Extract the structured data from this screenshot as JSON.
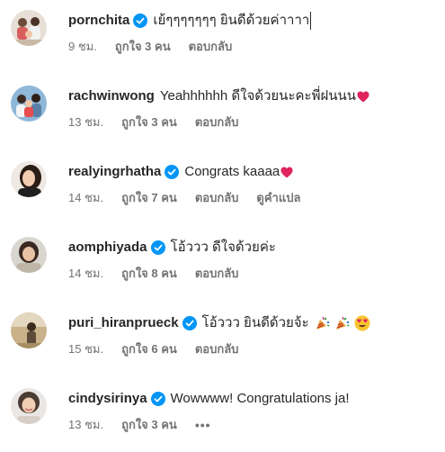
{
  "comments": [
    {
      "username": "pornchita",
      "verified": true,
      "text": "เย้ๆๆๆๆๆๆๆ ยินดีด้วยค่าาาา",
      "time": "9 ชม.",
      "likes": "ถูกใจ 3 คน",
      "reply": "ตอบกลับ",
      "avatar": "group-photo"
    },
    {
      "username": "rachwinwong",
      "verified": false,
      "text": "Yeahhhhhh ดีใจด้วยนะคะพี่ฝนนน",
      "emoji": [
        "heart"
      ],
      "time": "13 ชม.",
      "likes": "ถูกใจ 3 คน",
      "reply": "ตอบกลับ",
      "avatar": "family-photo"
    },
    {
      "username": "realyingrhatha",
      "verified": true,
      "text": "Congrats kaaaa",
      "emoji": [
        "heart"
      ],
      "time": "14 ชม.",
      "likes": "ถูกใจ 7 คน",
      "reply": "ตอบกลับ",
      "translate": "ดูคำแปล",
      "avatar": "portrait"
    },
    {
      "username": "aomphiyada",
      "verified": true,
      "text": "โอ้ววว ดีใจด้วยค่ะ",
      "time": "14 ชม.",
      "likes": "ถูกใจ 8 คน",
      "reply": "ตอบกลับ",
      "avatar": "portrait"
    },
    {
      "username": "puri_hiranprueck",
      "verified": true,
      "text": "โอ้ววว ยินดีด้วยจ้ะ",
      "emoji": [
        "party-popper",
        "party-popper",
        "heart-eyes"
      ],
      "time": "15 ชม.",
      "likes": "ถูกใจ 6 คน",
      "reply": "ตอบกลับ",
      "avatar": "outdoor-photo"
    },
    {
      "username": "cindysirinya",
      "verified": true,
      "text": "Wowwww! Congratulations ja!",
      "time": "13 ชม.",
      "likes": "ถูกใจ 3 คน",
      "more": "•••",
      "avatar": "portrait"
    }
  ],
  "colors": {
    "verified_blue": "#0095f6",
    "secondary_text": "#737373",
    "primary_text": "#262626",
    "heart_red": "#e0245e"
  }
}
